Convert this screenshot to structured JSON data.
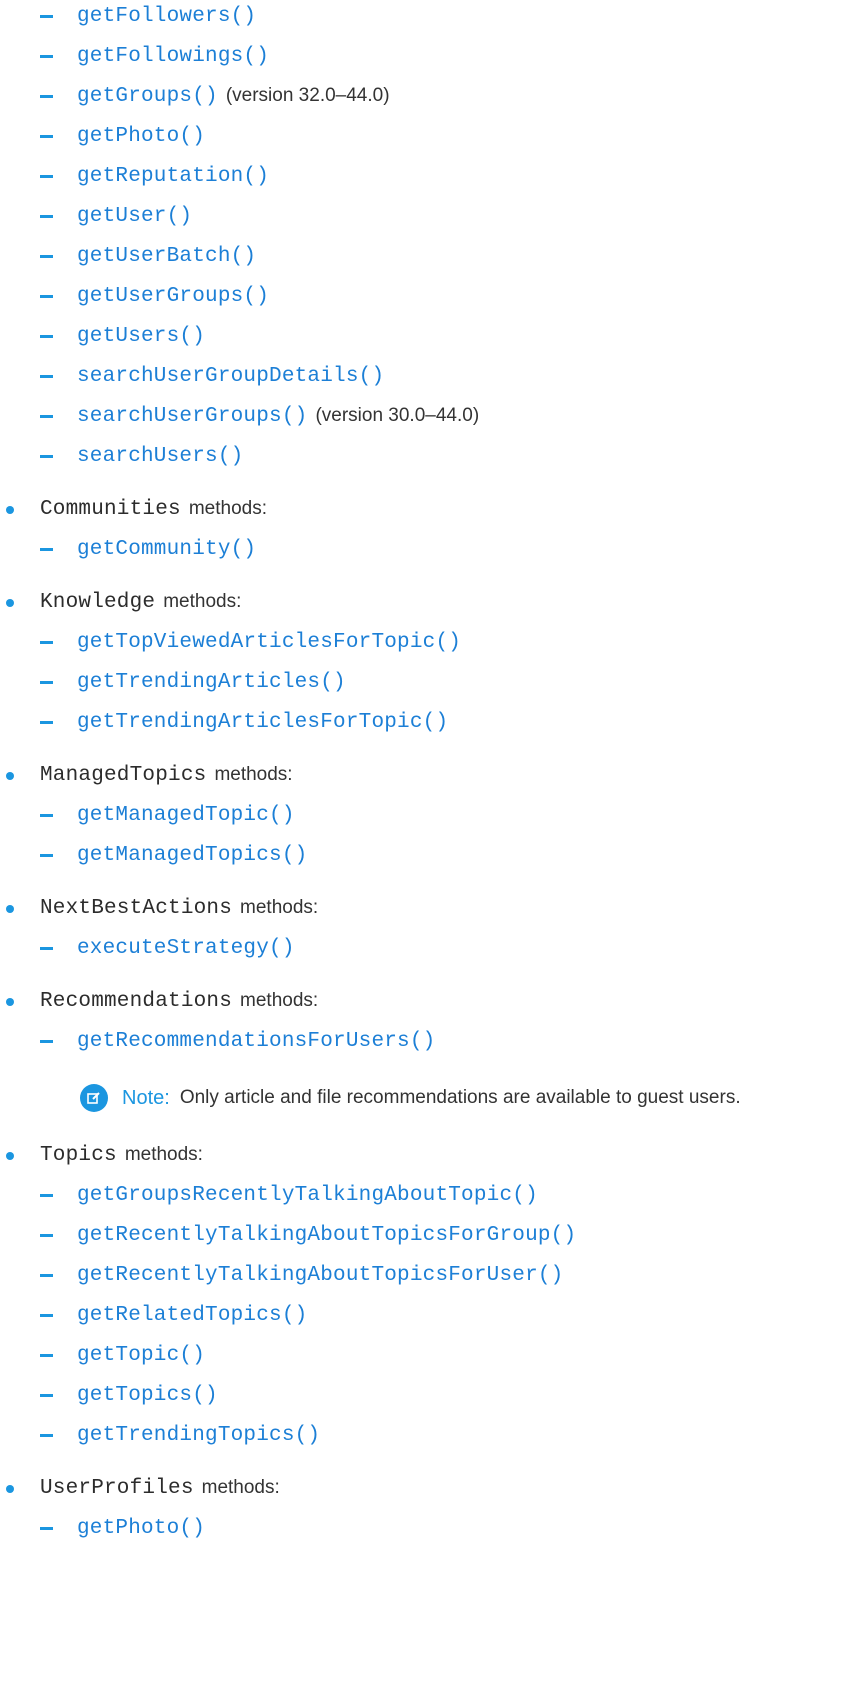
{
  "items": [
    {
      "kind": "sub",
      "name": "getFollowers()"
    },
    {
      "kind": "sub",
      "name": "getFollowings()"
    },
    {
      "kind": "sub",
      "name": "getGroups()",
      "suffix": "(version 32.0–44.0)"
    },
    {
      "kind": "sub",
      "name": "getPhoto()"
    },
    {
      "kind": "sub",
      "name": "getReputation()"
    },
    {
      "kind": "sub",
      "name": "getUser()"
    },
    {
      "kind": "sub",
      "name": "getUserBatch()"
    },
    {
      "kind": "sub",
      "name": "getUserGroups()"
    },
    {
      "kind": "sub",
      "name": "getUsers()"
    },
    {
      "kind": "sub",
      "name": "searchUserGroupDetails()"
    },
    {
      "kind": "sub",
      "name": "searchUserGroups()",
      "suffix": "(version 30.0–44.0)"
    },
    {
      "kind": "sub",
      "name": "searchUsers()"
    },
    {
      "kind": "top",
      "name": "Communities",
      "suffix": "methods:"
    },
    {
      "kind": "sub",
      "name": "getCommunity()"
    },
    {
      "kind": "top",
      "name": "Knowledge",
      "suffix": "methods:"
    },
    {
      "kind": "sub",
      "name": "getTopViewedArticlesForTopic()"
    },
    {
      "kind": "sub",
      "name": "getTrendingArticles()"
    },
    {
      "kind": "sub",
      "name": "getTrendingArticlesForTopic()"
    },
    {
      "kind": "top",
      "name": "ManagedTopics",
      "suffix": "methods:"
    },
    {
      "kind": "sub",
      "name": "getManagedTopic()"
    },
    {
      "kind": "sub",
      "name": "getManagedTopics()"
    },
    {
      "kind": "top",
      "name": "NextBestActions",
      "suffix": "methods:"
    },
    {
      "kind": "sub",
      "name": "executeStrategy()"
    },
    {
      "kind": "top",
      "name": "Recommendations",
      "suffix": "methods:"
    },
    {
      "kind": "sub",
      "name": "getRecommendationsForUsers()"
    },
    {
      "kind": "note",
      "label": "Note:",
      "text": "Only article and file recommendations are available to guest users."
    },
    {
      "kind": "top",
      "name": "Topics",
      "suffix": "methods:"
    },
    {
      "kind": "sub",
      "name": "getGroupsRecentlyTalkingAboutTopic()"
    },
    {
      "kind": "sub",
      "name": "getRecentlyTalkingAboutTopicsForGroup()"
    },
    {
      "kind": "sub",
      "name": "getRecentlyTalkingAboutTopicsForUser()"
    },
    {
      "kind": "sub",
      "name": "getRelatedTopics()"
    },
    {
      "kind": "sub",
      "name": "getTopic()"
    },
    {
      "kind": "sub",
      "name": "getTopics()"
    },
    {
      "kind": "sub",
      "name": "getTrendingTopics()"
    },
    {
      "kind": "top",
      "name": "UserProfiles",
      "suffix": "methods:"
    },
    {
      "kind": "sub",
      "name": "getPhoto()"
    }
  ],
  "colors": {
    "accent": "#1b96e0",
    "link": "#1c7fd6",
    "text": "#333333"
  }
}
